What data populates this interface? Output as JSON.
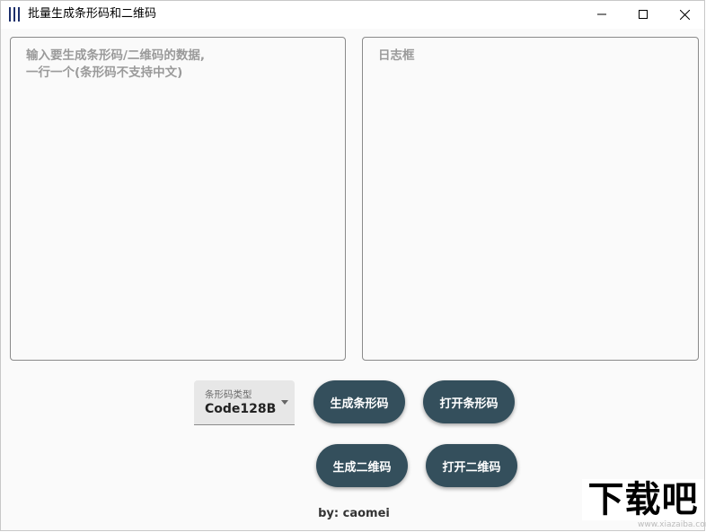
{
  "window": {
    "title": "批量生成条形码和二维码"
  },
  "icons": {
    "app": "barcode-icon",
    "minimize": "minimize-icon",
    "maximize": "maximize-icon",
    "close": "close-icon",
    "dropdown": "chevron-down-icon"
  },
  "input_panel": {
    "value": "",
    "placeholder": "输入要生成条形码/二维码的数据,\n一行一个(条形码不支持中文)"
  },
  "log_panel": {
    "value": "",
    "placeholder": "日志框"
  },
  "barcode_type": {
    "label": "条形码类型",
    "selected": "Code128B"
  },
  "buttons": {
    "generate_barcode": "生成条形码",
    "open_barcode": "打开条形码",
    "generate_qrcode": "生成二维码",
    "open_qrcode": "打开二维码"
  },
  "footer": {
    "credit": "by: caomei"
  },
  "watermark": {
    "logo_text": "下载吧",
    "url": "www.xiazaiba.com"
  },
  "colors": {
    "button_bg": "#344f5c",
    "button_text": "#ffffff",
    "icon_blue": "#1c2f6b"
  }
}
